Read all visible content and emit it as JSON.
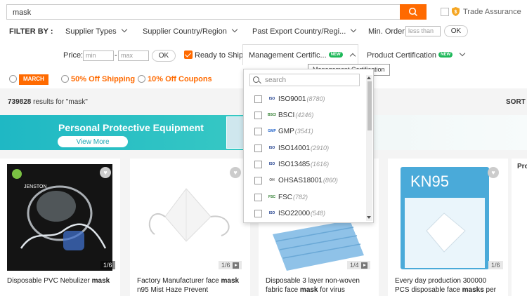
{
  "search": {
    "query": "mask"
  },
  "trade_assurance": {
    "label": "Trade Assurance"
  },
  "filters": {
    "filter_by": "FILTER BY :",
    "supplier_types": "Supplier Types",
    "supplier_country": "Supplier Country/Region",
    "past_export": "Past Export Country/Regi...",
    "min_order_label": "Min. Order:",
    "min_order_placeholder": "less than",
    "ok": "OK",
    "price_label": "Price:",
    "price_min_placeholder": "min",
    "price_dash": "-",
    "price_max_placeholder": "max",
    "ready_to_ship": "Ready to Ship",
    "management_cert": "Management Certific...",
    "product_cert": "Product Certification",
    "new_badge": "NEW"
  },
  "promos": {
    "march_label": "MARCH",
    "half_off": "50% Off Shipping",
    "ten_off": "10% Off Coupons"
  },
  "results": {
    "count": "739828",
    "suffix": " results for \"mask\"",
    "sort": "SORT"
  },
  "banner": {
    "title": "Personal Protective Equipment",
    "button": "View More"
  },
  "tooltip": "Management Certification",
  "dropdown": {
    "search_placeholder": "search",
    "items": [
      {
        "logo": "ISO",
        "name": "ISO9001",
        "count": "(8780)"
      },
      {
        "logo": "BSCI",
        "name": "BSCI",
        "count": "(4246)"
      },
      {
        "logo": "GMP",
        "name": "GMP",
        "count": "(3541)"
      },
      {
        "logo": "ISO",
        "name": "ISO14001",
        "count": "(2910)"
      },
      {
        "logo": "ISO",
        "name": "ISO13485",
        "count": "(1616)"
      },
      {
        "logo": "OH",
        "name": "OHSAS18001",
        "count": "(860)"
      },
      {
        "logo": "FSC",
        "name": "FSC",
        "count": "(782)"
      },
      {
        "logo": "ISO",
        "name": "ISO22000",
        "count": "(548)"
      }
    ]
  },
  "products": [
    {
      "pager": "1/6",
      "title_pre": "Disposable PVC Nebulizer ",
      "title_bold": "mask",
      "title_post": "",
      "line2": "",
      "brand": "JENSTON"
    },
    {
      "pager": "1/6",
      "title_pre": "Factory Manufacturer face ",
      "title_bold": "mask",
      "title_post": "",
      "line2": "n95 Mist Haze Prevent"
    },
    {
      "pager": "1/4",
      "title_pre": "Disposable 3 layer non-woven",
      "title_bold": "",
      "title_post": "",
      "line2_pre": "fabric face ",
      "line2_bold": "mask",
      "line2_post": " for virus"
    },
    {
      "pager": "1/6",
      "title_pre": "Every day production 300000",
      "title_bold": "",
      "title_post": "",
      "line2_pre": "PCS disposable face ",
      "line2_bold": "masks",
      "line2_post": " per",
      "kn95": "KN95"
    }
  ],
  "side_label": "Pro",
  "colors": {
    "accent": "#ff6a00",
    "new_badge": "#1fb85a",
    "banner": "#1fb8c4"
  }
}
